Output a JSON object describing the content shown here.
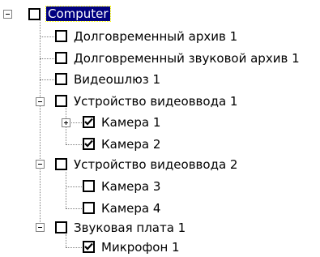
{
  "tree": {
    "root": {
      "label": "Computer",
      "selected": true,
      "checked": false
    },
    "items": [
      {
        "label": "Долговременный архив 1",
        "checked": false
      },
      {
        "label": "Долговременный звуковой архив 1",
        "checked": false
      },
      {
        "label": "Видеошлюз 1",
        "checked": false
      },
      {
        "label": "Устройство видеоввода 1",
        "checked": false
      },
      {
        "label": "Камера 1",
        "checked": true
      },
      {
        "label": "Камера 2",
        "checked": true
      },
      {
        "label": "Устройство видеоввода 2",
        "checked": false
      },
      {
        "label": "Камера 3",
        "checked": false
      },
      {
        "label": "Камера 4",
        "checked": false
      },
      {
        "label": "Звуковая плата 1",
        "checked": false
      },
      {
        "label": "Микрофон 1",
        "checked": true
      }
    ]
  }
}
